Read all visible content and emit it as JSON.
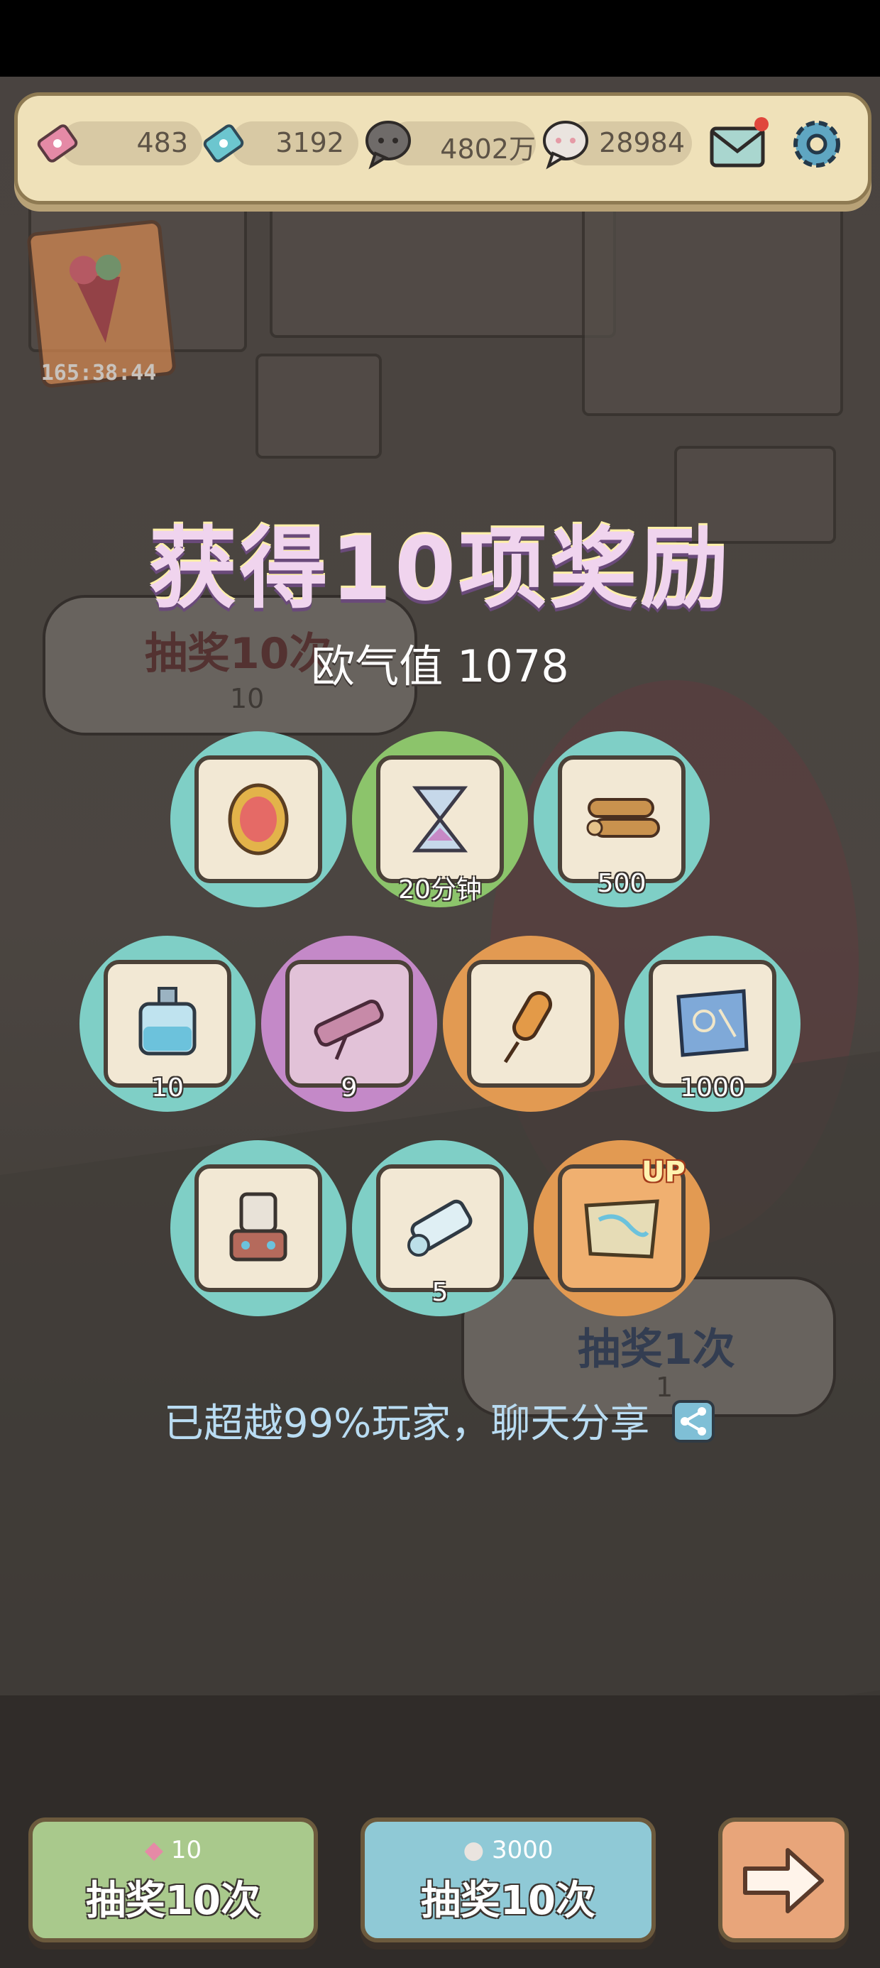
{
  "resources": {
    "ticket_pink": "483",
    "ticket_blue": "3192",
    "coin_dark": "4802万",
    "coin_light": "28984"
  },
  "event_timer": "165:38:44",
  "background": {
    "draw10_label": "抽奖10次",
    "draw10_cost": "10",
    "draw1_label": "抽奖1次",
    "draw1_cost": "1"
  },
  "result": {
    "title": "获得10项奖励",
    "luck_label": "欧气值",
    "luck_value": "1078",
    "items": [
      {
        "icon": "gold-mirror-icon",
        "ring": "#7fcfc6",
        "qty": ""
      },
      {
        "icon": "hourglass-icon",
        "ring": "#8cc46b",
        "qty": "20分钟"
      },
      {
        "icon": "wood-logs-icon",
        "ring": "#7fcfc6",
        "qty": "500"
      },
      {
        "icon": "perfume-bottle-icon",
        "ring": "#7fcfc6",
        "qty": "10"
      },
      {
        "icon": "telescope-icon",
        "ring": "#c489c8",
        "qty": "9"
      },
      {
        "icon": "corndog-icon",
        "ring": "#e29a52",
        "qty": ""
      },
      {
        "icon": "blueprint-icon",
        "ring": "#7fcfc6",
        "qty": "1000"
      },
      {
        "icon": "machine-tower-icon",
        "ring": "#7fcfc6",
        "qty": ""
      },
      {
        "icon": "scroll-icon",
        "ring": "#7fcfc6",
        "qty": "5"
      },
      {
        "icon": "treasure-map-icon",
        "ring": "#e29a52",
        "qty": "",
        "badge": "UP"
      }
    ],
    "share_text": "已超越99%玩家，聊天分享"
  },
  "buttons": {
    "ticket_draw": {
      "cost": "10",
      "label": "抽奖10次"
    },
    "coin_draw": {
      "cost": "3000",
      "label": "抽奖10次"
    }
  },
  "colors": {
    "ring_teal": "#7fcfc6",
    "ring_green": "#8cc46b",
    "ring_purple": "#c489c8",
    "ring_orange": "#e29a52",
    "button_green": "#a9c98c",
    "button_blue": "#8fc9d6",
    "button_orange": "#e8a57a"
  }
}
